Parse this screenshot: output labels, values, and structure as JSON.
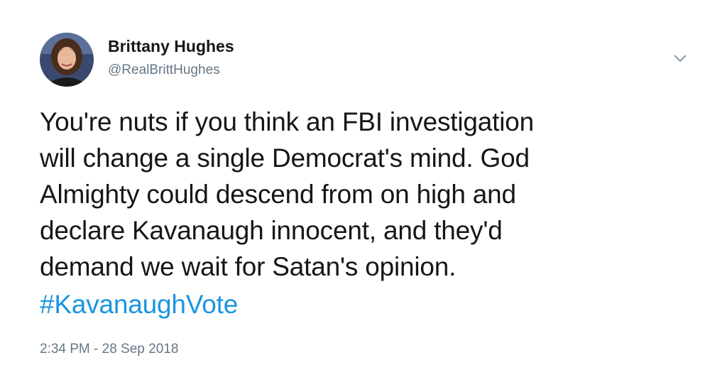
{
  "author": {
    "display_name": "Brittany Hughes",
    "handle": "@RealBrittHughes"
  },
  "tweet": {
    "lines": [
      "You're nuts if you think an FBI investigation",
      "will change a single Democrat's mind. God",
      "Almighty could descend from on high and",
      "declare Kavanaugh innocent, and they'd",
      "demand we wait for Satan's opinion."
    ],
    "hashtag": "#KavanaughVote",
    "timestamp": "2:34 PM - 28 Sep 2018"
  },
  "icons": {
    "menu": "chevron-down-icon",
    "avatar": "profile-photo"
  },
  "colors": {
    "text": "#14171a",
    "secondary": "#657786",
    "link": "#1b95e0",
    "background": "#ffffff"
  }
}
